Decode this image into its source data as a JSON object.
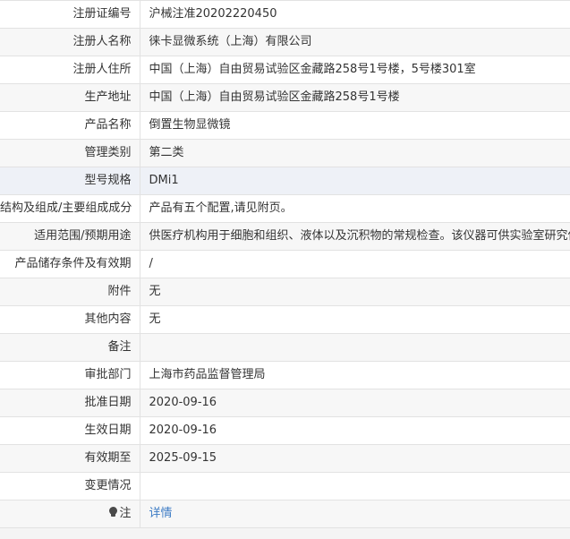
{
  "rows": [
    {
      "label": "注册证编号",
      "value": "沪械注准20202220450"
    },
    {
      "label": "注册人名称",
      "value": "徕卡显微系统（上海）有限公司"
    },
    {
      "label": "注册人住所",
      "value": "中国（上海）自由贸易试验区金藏路258号1号楼，5号楼301室"
    },
    {
      "label": "生产地址",
      "value": "中国（上海）自由贸易试验区金藏路258号1号楼"
    },
    {
      "label": "产品名称",
      "value": "倒置生物显微镜"
    },
    {
      "label": "管理类别",
      "value": "第二类"
    },
    {
      "label": "型号规格",
      "value": "DMi1"
    },
    {
      "label": "结构及组成/主要组成成分",
      "value": "产品有五个配置,请见附页。"
    },
    {
      "label": "适用范围/预期用途",
      "value": "供医疗机构用于细胞和组织、液体以及沉积物的常规检查。该仪器可供实验室研究使用"
    },
    {
      "label": "产品储存条件及有效期",
      "value": "/"
    },
    {
      "label": "附件",
      "value": "无"
    },
    {
      "label": "其他内容",
      "value": "无"
    },
    {
      "label": "备注",
      "value": ""
    },
    {
      "label": "审批部门",
      "value": "上海市药品监督管理局"
    },
    {
      "label": "批准日期",
      "value": "2020-09-16"
    },
    {
      "label": "生效日期",
      "value": "2020-09-16"
    },
    {
      "label": "有效期至",
      "value": "2025-09-15"
    },
    {
      "label": "变更情况",
      "value": ""
    }
  ],
  "note_row": {
    "icon": "lightbulb-icon",
    "label": "注",
    "link_text": "详情"
  },
  "colors": {
    "link": "#3c7bc4",
    "border": "#e2e2e2",
    "row_alt": "#f7f7f7",
    "row_highlight": "#eef1f7"
  }
}
